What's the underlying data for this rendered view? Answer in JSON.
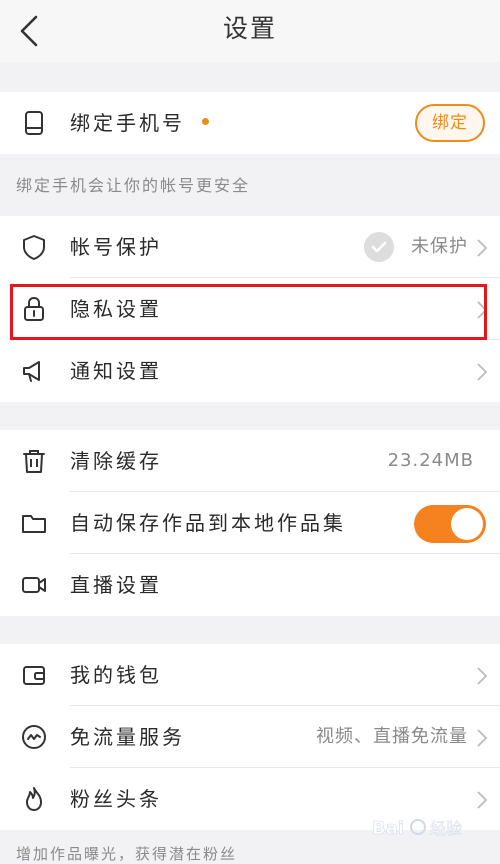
{
  "header": {
    "title": "设置"
  },
  "phone_section": {
    "label": "绑定手机号",
    "button_label": "绑定",
    "hint": "绑定手机会让你的帐号更安全"
  },
  "security_section": {
    "items": [
      {
        "label": "帐号保护",
        "value": "未保护"
      },
      {
        "label": "隐私设置"
      },
      {
        "label": "通知设置"
      }
    ]
  },
  "storage_section": {
    "items": [
      {
        "label": "清除缓存",
        "value": "23.24MB"
      },
      {
        "label": "自动保存作品到本地作品集",
        "toggle_on": true
      },
      {
        "label": "直播设置"
      }
    ]
  },
  "wallet_section": {
    "items": [
      {
        "label": "我的钱包"
      },
      {
        "label": "免流量服务",
        "value": "视频、直播免流量"
      },
      {
        "label": "粉丝头条"
      }
    ]
  },
  "footer": {
    "text": "增加作品曝光，获得潜在粉丝"
  },
  "colors": {
    "accent": "#f5821f",
    "highlight": "#e8141d"
  },
  "watermark": {
    "text": "Bai 经验"
  }
}
